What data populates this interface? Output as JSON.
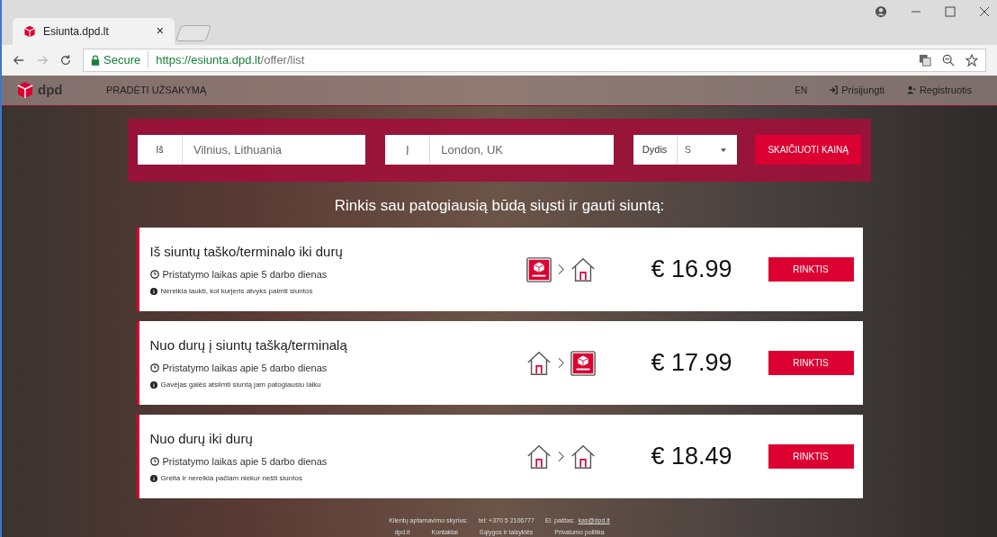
{
  "browser": {
    "tab_title": "Esiunta.dpd.lt",
    "tab_close": "×",
    "secure_label": "Secure",
    "url_host": "https://esiunta.dpd.lt",
    "url_path": "/offer/list"
  },
  "nav": {
    "logo": "dpd",
    "items": [
      "PRADĖTI UŽSAKYMĄ"
    ],
    "language": "EN",
    "login": "Prisijungti",
    "register": "Registruotis"
  },
  "search": {
    "from_label": "Iš",
    "from_value": "Vilnius, Lithuania",
    "to_label": "Į",
    "to_value": "London, UK",
    "size_label": "Dydis",
    "size_value": "S",
    "button": "SKAIČIUOTI KAINĄ"
  },
  "heading": "Rinkis sau patogiausią būdą siųsti ir gauti siuntą:",
  "offers": [
    {
      "title": "Iš siuntų taško/terminalo iki durų",
      "delivery": "Pristatymo laikas apie 5 darbo dienas",
      "note": "Nereikia laukti, kol kurjeris atvyks paimti siuntos",
      "route": [
        {
          "kind": "terminal"
        },
        {
          "kind": "home"
        }
      ],
      "price": "€ 16.99",
      "button": "RINKTIS"
    },
    {
      "title": "Nuo durų į siuntų tašką/terminalą",
      "delivery": "Pristatymo laikas apie 5 darbo dienas",
      "note": "Gavėjas galės atsiimti siuntą jam patogiausiu laiku",
      "route": [
        {
          "kind": "home"
        },
        {
          "kind": "terminal"
        }
      ],
      "price": "€ 17.99",
      "button": "RINKTIS"
    },
    {
      "title": "Nuo durų iki durų",
      "delivery": "Pristatymo laikas apie 5 darbo dienas",
      "note": "Greita ir nereikia pačiam niekur nešti siuntos",
      "route": [
        {
          "kind": "home"
        },
        {
          "kind": "home"
        }
      ],
      "price": "€ 18.49",
      "button": "RINKTIS"
    }
  ],
  "footer": {
    "service_label": "Klientų aptarnavimo skyrius:",
    "phone": "tel: +370 5 2106777",
    "email_label": "El. paštas:",
    "email": "kas@dpd.lt",
    "links": [
      "dpd.lt",
      "Kontaktai",
      "Sąlygos ir taisyklės",
      "Privatumo politika"
    ]
  }
}
